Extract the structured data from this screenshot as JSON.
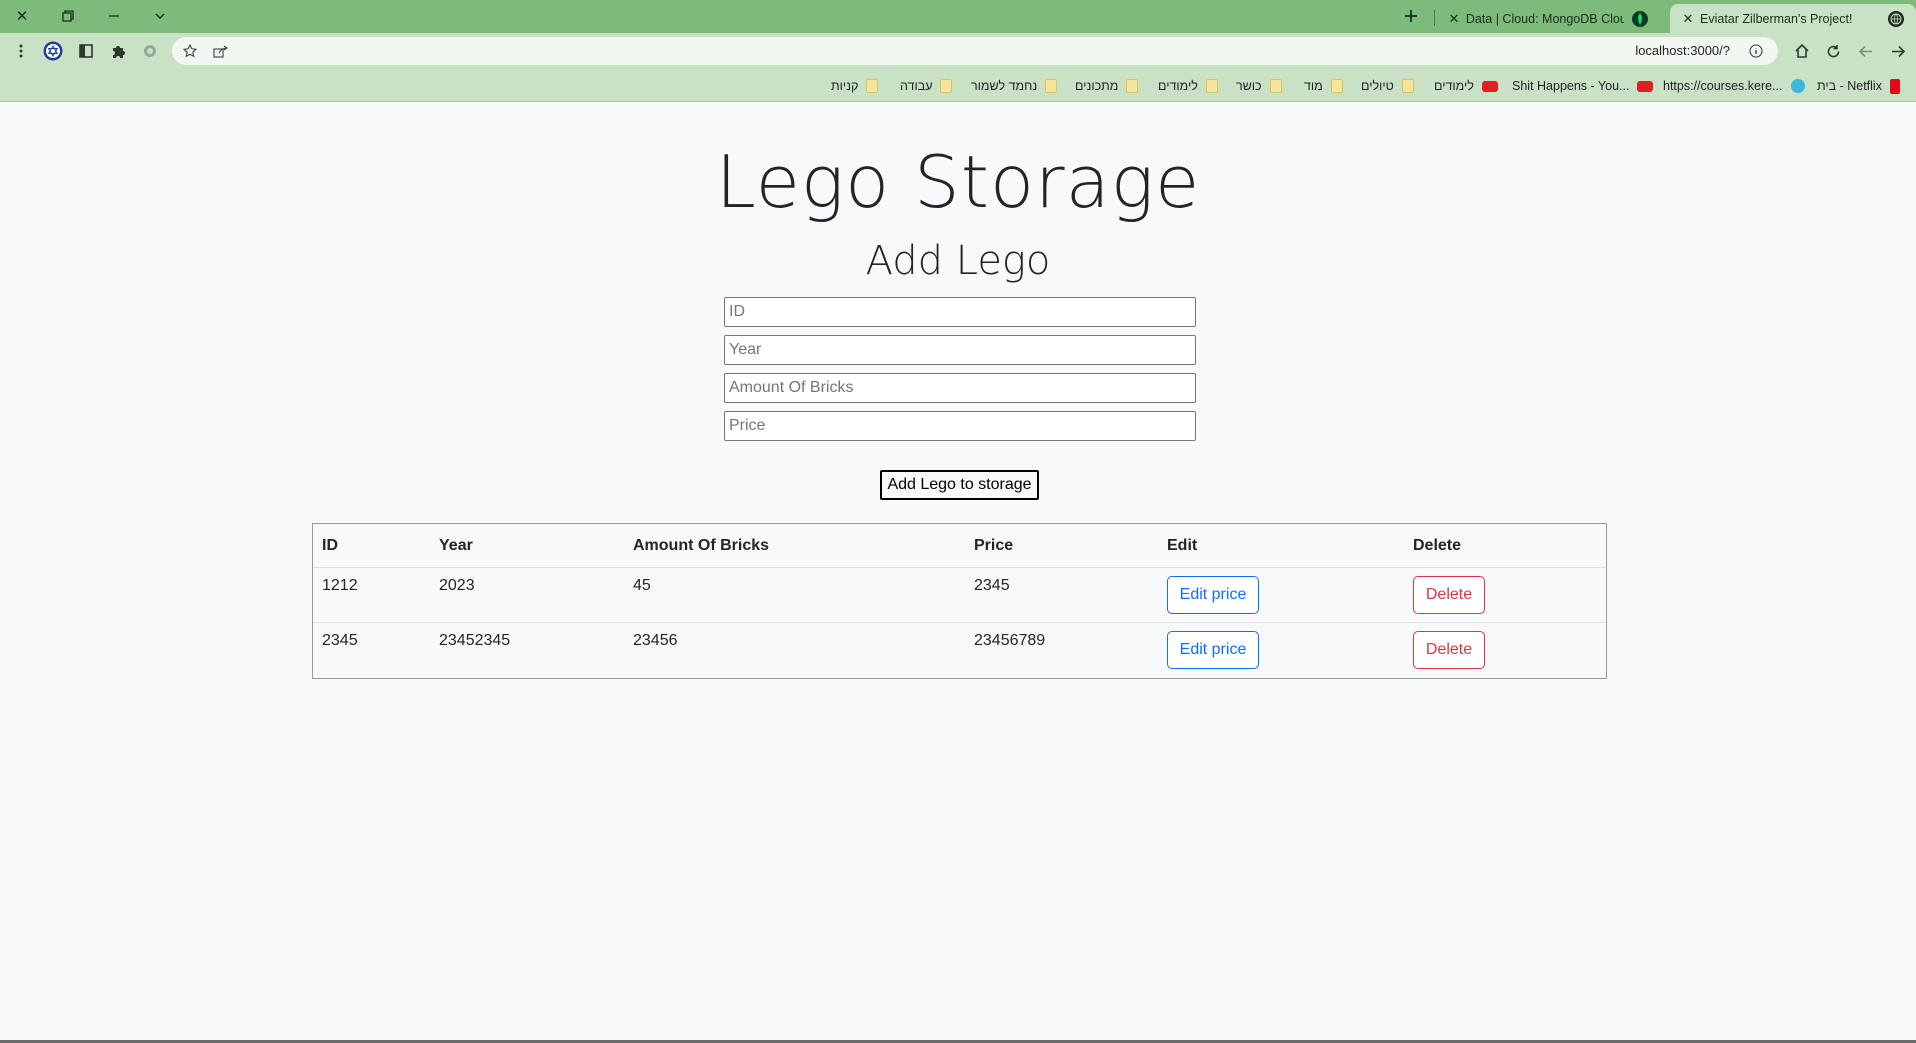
{
  "browser": {
    "tabs": [
      {
        "title": "Data | Cloud: MongoDB Cloud"
      },
      {
        "title": "Eviatar Zilberman's Project!"
      }
    ],
    "url": "localhost:3000/?",
    "bookmarks": [
      {
        "label": "בית - Netflix",
        "icon": "netflix"
      },
      {
        "label": "https://courses.kere...",
        "icon": "courses"
      },
      {
        "label": "Shit Happens - You...",
        "icon": "youtube"
      },
      {
        "label": "לימודים",
        "icon": "youtube"
      },
      {
        "label": "טיולים",
        "icon": "folder"
      },
      {
        "label": "מוד",
        "icon": "folder"
      },
      {
        "label": "כושר",
        "icon": "folder"
      },
      {
        "label": "לימודים",
        "icon": "folder"
      },
      {
        "label": "מתכונים",
        "icon": "folder"
      },
      {
        "label": "נחמד לשמור",
        "icon": "folder"
      },
      {
        "label": "עבודה",
        "icon": "folder"
      },
      {
        "label": "קניות",
        "icon": "folder"
      }
    ]
  },
  "page": {
    "title": "Lego Storage",
    "subtitle": "Add Lego",
    "form": {
      "id_placeholder": "ID",
      "year_placeholder": "Year",
      "bricks_placeholder": "Amount Of Bricks",
      "price_placeholder": "Price",
      "submit_label": "Add Lego to storage"
    },
    "table": {
      "headers": {
        "id": "ID",
        "year": "Year",
        "bricks": "Amount Of Bricks",
        "price": "Price",
        "edit": "Edit",
        "delete": "Delete"
      },
      "rows": [
        {
          "id": "1212",
          "year": "2023",
          "bricks": "45",
          "price": "2345",
          "edit_label": "Edit price",
          "delete_label": "Delete"
        },
        {
          "id": "2345",
          "year": "23452345",
          "bricks": "23456",
          "price": "23456789",
          "edit_label": "Edit price",
          "delete_label": "Delete"
        }
      ]
    }
  },
  "colors": {
    "tabbar": "#7cbb7a",
    "toolbar": "#c9e2c5",
    "edit_button": "#0d6efd",
    "delete_button": "#dc3545"
  }
}
